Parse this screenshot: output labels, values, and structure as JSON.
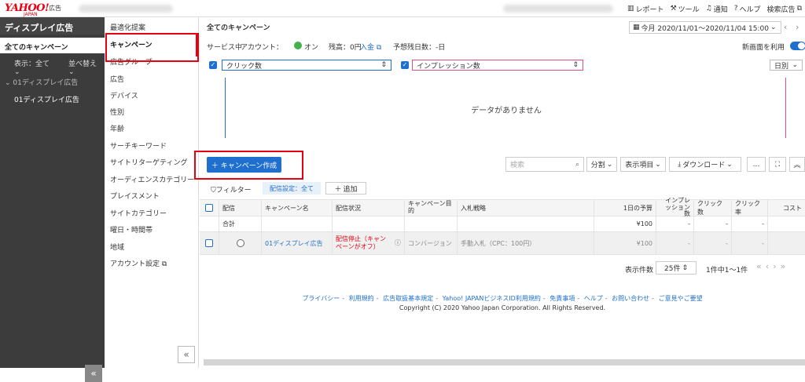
{
  "header": {
    "logo_text": "YAHOO!",
    "logo_sub": "JAPAN",
    "logo_ad": "広告",
    "nav": [
      {
        "label": "レポート",
        "icon": "chart-icon"
      },
      {
        "label": "ツール",
        "icon": "wrench-icon"
      },
      {
        "label": "通知",
        "icon": "bell-icon"
      },
      {
        "label": "ヘルプ",
        "icon": "help-icon"
      },
      {
        "label": "検索広告",
        "icon": "external-link-icon"
      }
    ]
  },
  "sidebar": {
    "title": "ディスプレイ広告",
    "all_campaigns": "全てのキャンペーン",
    "display_label": "表示：全て",
    "sort_label": "並べ替え",
    "group_label": "01ディスプレイ広告",
    "campaign_item": "01ディスプレイ広告",
    "collapse_glyph": "«"
  },
  "nav": {
    "items": [
      "最適化提案",
      "キャンペーン",
      "広告グループ",
      "広告",
      "デバイス",
      "性別",
      "年齢",
      "サーチキーワード",
      "サイトリターゲティング",
      "オーディエンスカテゴリー",
      "プレイスメント",
      "サイトカテゴリー",
      "曜日・時間帯",
      "地域",
      "アカウント設定"
    ],
    "active_index": 1,
    "collapse_glyph": "«"
  },
  "main": {
    "title": "全てのキャンペーン",
    "date_range": "今月 2020/11/01〜2020/11/04 15:00",
    "service_status": "サービス中",
    "account_label": "アカウント：",
    "account_status": "オン",
    "balance_label": "残高：0円",
    "deposit_link": "入金",
    "remaining_days": "予想残日数：-日",
    "new_screen_label": "新画面を利用",
    "metric1": "クリック数",
    "metric2": "インプレッション数",
    "period": "日別",
    "no_data": "データがありません",
    "create_button": "キャンペーン作成",
    "search_placeholder": "検索",
    "split_label": "分割",
    "columns_label": "表示項目",
    "download_label": "ダウンロード",
    "more_label": "…",
    "filter_label": "フィルター",
    "filter_tag": "配信設定：全て",
    "add_label": "追加",
    "accent": "#1f6fce",
    "alert_color": "#e60012"
  },
  "table": {
    "headers": [
      "配信",
      "キャンペーン名",
      "配信状況",
      "キャンペーン目的",
      "入札戦略",
      "1日の予算",
      "インプレッション数",
      "クリック数",
      "クリック率",
      "コスト"
    ],
    "total_row": {
      "label": "合計",
      "budget": "¥100",
      "impressions": "-",
      "clicks": "-",
      "ctr": "-"
    },
    "rows": [
      {
        "name": "01ディスプレイ広告",
        "status": "配信停止（キャンペーンがオフ）",
        "objective": "コンバージョン",
        "bidding": "手動入札（CPC：100円）",
        "budget": "¥100",
        "impressions": "-",
        "clicks": "-",
        "ctr": "-"
      }
    ]
  },
  "pagination": {
    "rows_label": "表示件数",
    "rows_value": "25件",
    "range_text": "1件中1〜1件"
  },
  "footer": {
    "links": [
      "プライバシー",
      "利用規約",
      "広告取扱基本規定",
      "Yahoo! JAPANビジネスID利用規約",
      "免責事項",
      "ヘルプ",
      "お問い合わせ",
      "ご意見やご要望"
    ],
    "copyright": "Copyright (C) 2020 Yahoo Japan Corporation. All Rights Reserved."
  }
}
